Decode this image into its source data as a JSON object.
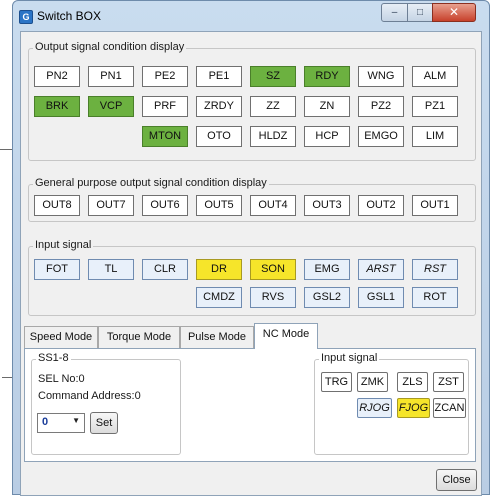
{
  "window": {
    "title": "Switch BOX",
    "icon": "app-icon",
    "controls": {
      "minimize": "–",
      "maximize": "□",
      "close": "✕"
    }
  },
  "colors": {
    "active_green": "#6cb140",
    "active_yellow": "#f6e52a",
    "highlight_blue": "#e8f0fa"
  },
  "output_signals": {
    "legend": "Output signal condition display",
    "row1": [
      {
        "label": "PN2",
        "state": "off"
      },
      {
        "label": "PN1",
        "state": "off"
      },
      {
        "label": "PE2",
        "state": "off"
      },
      {
        "label": "PE1",
        "state": "off"
      },
      {
        "label": "SZ",
        "state": "green"
      },
      {
        "label": "RDY",
        "state": "green"
      },
      {
        "label": "WNG",
        "state": "off"
      },
      {
        "label": "ALM",
        "state": "off"
      }
    ],
    "row2": [
      {
        "label": "BRK",
        "state": "green"
      },
      {
        "label": "VCP",
        "state": "green"
      },
      {
        "label": "PRF",
        "state": "off"
      },
      {
        "label": "ZRDY",
        "state": "off"
      },
      {
        "label": "ZZ",
        "state": "off"
      },
      {
        "label": "ZN",
        "state": "off"
      },
      {
        "label": "PZ2",
        "state": "off"
      },
      {
        "label": "PZ1",
        "state": "off"
      }
    ],
    "row3": [
      {
        "label": "MTON",
        "state": "green"
      },
      {
        "label": "OTO",
        "state": "off"
      },
      {
        "label": "HLDZ",
        "state": "off"
      },
      {
        "label": "HCP",
        "state": "off"
      },
      {
        "label": "EMGO",
        "state": "off"
      },
      {
        "label": "LIM",
        "state": "off"
      }
    ]
  },
  "general_outputs": {
    "legend": "General purpose output signal condition display",
    "items": [
      "OUT8",
      "OUT7",
      "OUT6",
      "OUT5",
      "OUT4",
      "OUT3",
      "OUT2",
      "OUT1"
    ]
  },
  "input_signals": {
    "legend": "Input signal",
    "row1": [
      {
        "label": "FOT",
        "state": "blue"
      },
      {
        "label": "TL",
        "state": "blue"
      },
      {
        "label": "CLR",
        "state": "blue"
      },
      {
        "label": "DR",
        "state": "yellow"
      },
      {
        "label": "SON",
        "state": "yellow"
      },
      {
        "label": "EMG",
        "state": "blue"
      },
      {
        "label": "ARST",
        "state": "blue-italic"
      },
      {
        "label": "RST",
        "state": "blue-italic"
      }
    ],
    "row2": [
      {
        "label": "CMDZ",
        "state": "blue"
      },
      {
        "label": "RVS",
        "state": "blue"
      },
      {
        "label": "GSL2",
        "state": "blue"
      },
      {
        "label": "GSL1",
        "state": "blue"
      },
      {
        "label": "ROT",
        "state": "blue"
      }
    ]
  },
  "tabs": [
    {
      "label": "Speed Mode",
      "active": false
    },
    {
      "label": "Torque Mode",
      "active": false
    },
    {
      "label": "Pulse Mode",
      "active": false
    },
    {
      "label": "NC Mode",
      "active": true
    }
  ],
  "nc_mode": {
    "ss_group": {
      "legend": "SS1-8",
      "sel_no": "SEL No:0",
      "command_address": "Command Address:0",
      "select_value": "0",
      "set_label": "Set"
    },
    "input_group": {
      "legend": "Input signal",
      "row1": [
        "TRG",
        "ZMK",
        "ZLS",
        "ZST"
      ],
      "row2": [
        {
          "label": "RJOG",
          "state": "blue-italic"
        },
        {
          "label": "FJOG",
          "state": "yellow-italic"
        },
        {
          "label": "ZCAN",
          "state": "plain"
        }
      ]
    }
  },
  "close_label": "Close"
}
